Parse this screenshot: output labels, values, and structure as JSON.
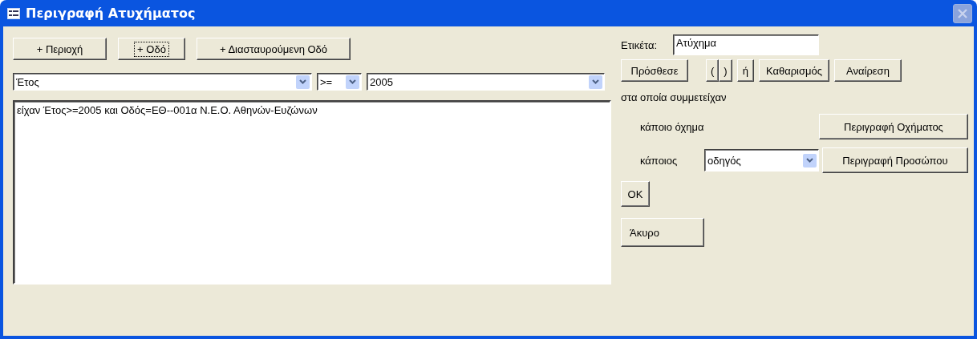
{
  "window": {
    "title": "Περιγραφή Ατυχήματος",
    "close_disabled": true
  },
  "add_buttons": [
    {
      "label": "+ Περιοχή",
      "focused": false
    },
    {
      "label": "+ Οδό",
      "focused": true
    },
    {
      "label": "+ Διασταυρούμενη Οδό",
      "focused": false
    }
  ],
  "field_combo": {
    "value": "Έτος"
  },
  "operator_combo": {
    "value": ">="
  },
  "value_combo": {
    "value": "2005"
  },
  "criteria_text": "είχαν  Έτος>=2005 και Οδός=ΕΘ--001α Ν.Ε.Ο.  Αθηνών-Ευζώνων",
  "label_field": {
    "label": "Ετικέτα:",
    "value": "Ατύχημα"
  },
  "action_buttons": [
    {
      "kind": "normal",
      "label": "Πρόσθεσε"
    },
    {
      "kind": "pair",
      "labels": [
        "(",
        ")"
      ]
    },
    {
      "kind": "normal",
      "label": "ή"
    },
    {
      "kind": "normal",
      "label": "Καθαρισμός"
    },
    {
      "kind": "normal",
      "label": "Αναίρεση"
    }
  ],
  "participants_label": "στα οποία συμμετείχαν",
  "vehicle": {
    "label": "κάποιο όχημα",
    "button": "Περιγραφή Οχήματος"
  },
  "person": {
    "label": "κάποιος",
    "value": "οδηγός",
    "button": "Περιγραφή Προσώπου"
  },
  "ok_button": "OK",
  "cancel_button": "Άκυρο"
}
